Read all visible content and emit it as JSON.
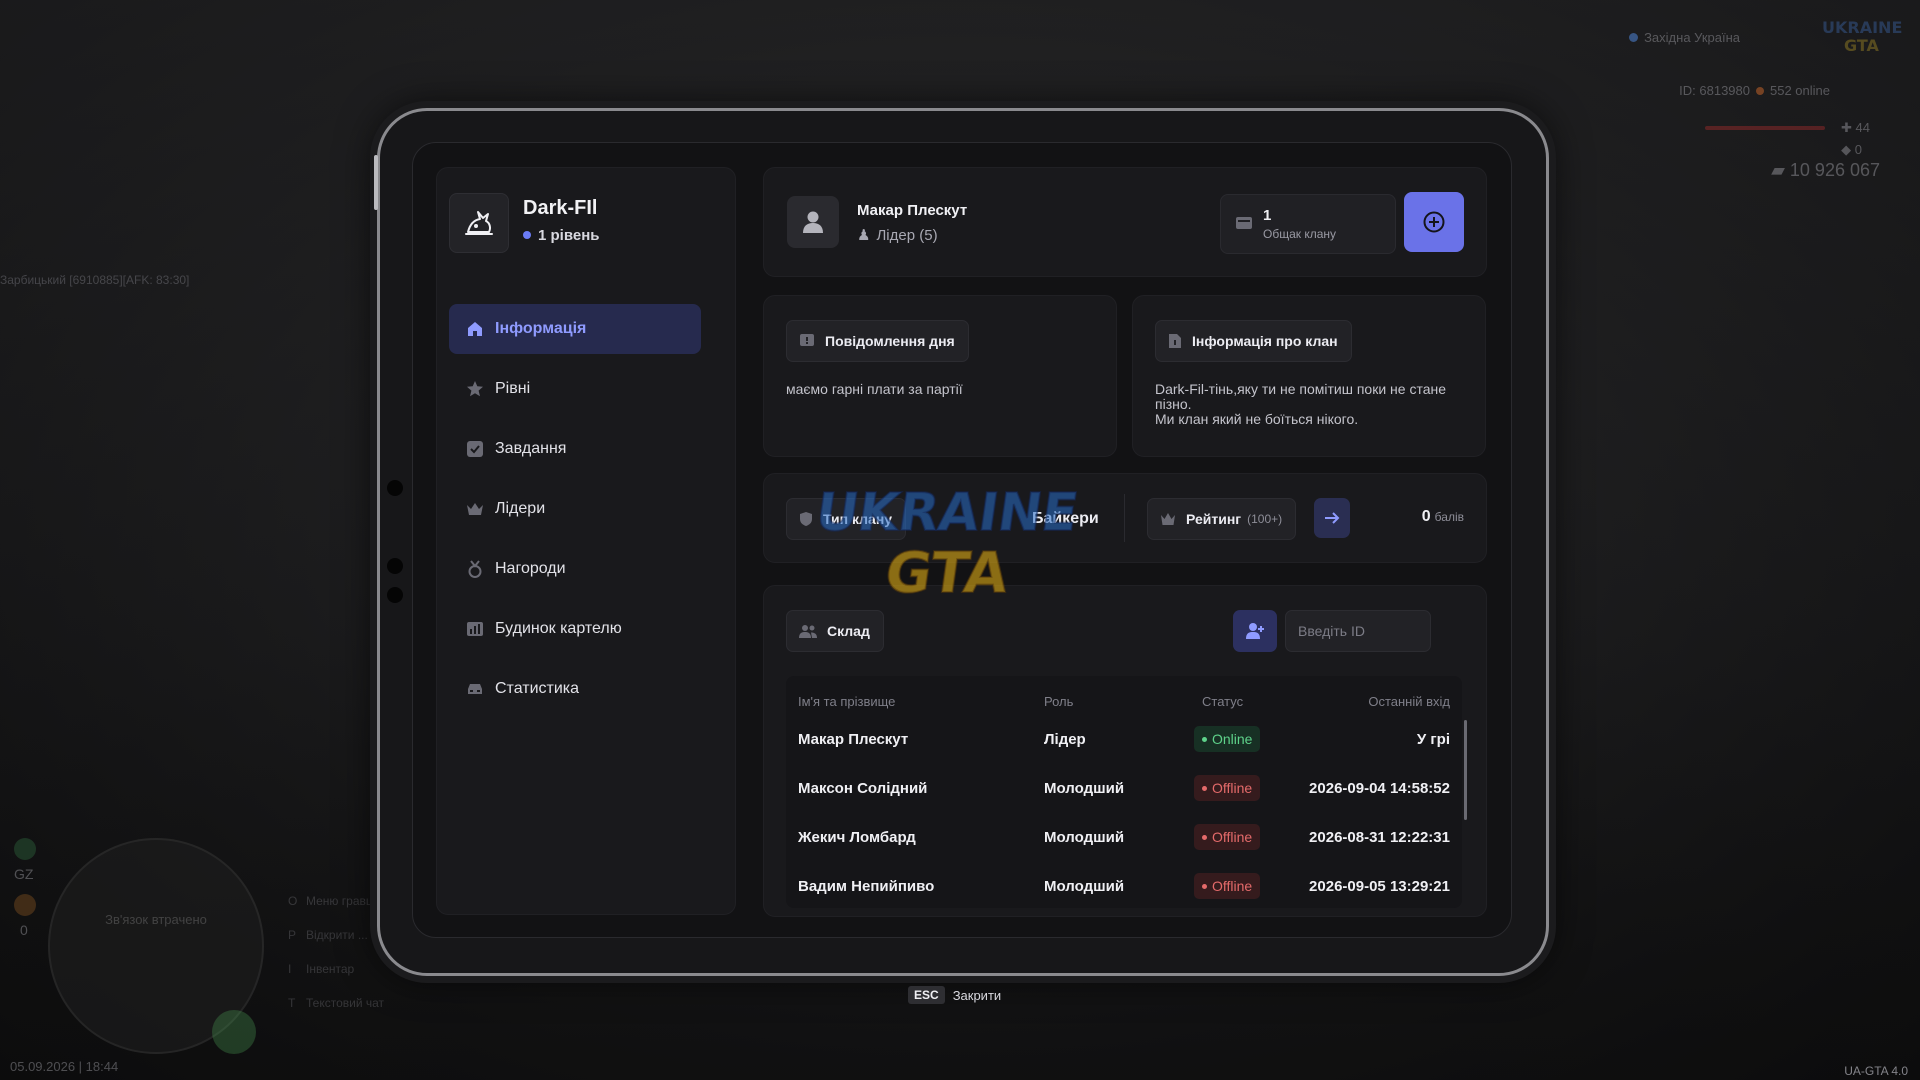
{
  "hud": {
    "region": "Західна Україна",
    "server_id": "ID: 6813980",
    "online": "552 online",
    "hp": "44",
    "armor": "0",
    "money": "10 926 067",
    "player_tag": "Зарбицький [6910885][AFK: 83:30]",
    "datetime": "05.09.2026 | 18:44",
    "version": "UA-GTA 4.0",
    "minimap_text": "Зв'язок втрачено",
    "minimap_label": "GZ",
    "minimap_value": "0",
    "keys": [
      {
        "key": "O",
        "label": "Меню гравця"
      },
      {
        "key": "P",
        "label": "Відкрити ..."
      },
      {
        "key": "I",
        "label": "Інвентар"
      },
      {
        "key": "T",
        "label": "Текстовий чат"
      }
    ]
  },
  "watermark": {
    "line1": "UKRAINE",
    "line2": "GTA"
  },
  "clan": {
    "name": "Dark-FIl",
    "level": "1 рівень"
  },
  "nav": [
    {
      "label": "Інформація",
      "icon": "home-icon",
      "active": true
    },
    {
      "label": "Рівні",
      "icon": "star-icon"
    },
    {
      "label": "Завдання",
      "icon": "checkbox-icon"
    },
    {
      "label": "Лідери",
      "icon": "crown-icon"
    },
    {
      "label": "Нагороди",
      "icon": "medal-icon"
    },
    {
      "label": "Будинок картелю",
      "icon": "building-icon"
    },
    {
      "label": "Статистика",
      "icon": "car-icon"
    }
  ],
  "leader": {
    "name": "Макар Плескут",
    "role": "Лідер (5)"
  },
  "bank": {
    "value": "1",
    "label": "Общак клану"
  },
  "motd": {
    "title": "Повідомлення дня",
    "text": "маємо гарні плати за партії"
  },
  "info": {
    "title": "Інформація про клан",
    "line1": "Dark-Fil-тінь,яку ти не помітиш поки не стане пізно.",
    "line2": "Ми клан який не боїться нікого."
  },
  "clan_type": {
    "title": "Тип клану",
    "value": "Байкери"
  },
  "rating": {
    "title": "Рейтинг",
    "sub": "(100+)",
    "points": "0",
    "unit": "балів"
  },
  "roster": {
    "title": "Склад",
    "input_placeholder": "Введіть ID",
    "columns": [
      "Ім'я та прізвище",
      "Роль",
      "Статус",
      "Останній вхід"
    ],
    "rows": [
      {
        "name": "Макар Плескут",
        "role": "Лідер",
        "status": "Online",
        "last": "У грі"
      },
      {
        "name": "Максон Солідний",
        "role": "Молодший",
        "status": "Offline",
        "last": "2026-09-04 14:58:52"
      },
      {
        "name": "Жекич Ломбард",
        "role": "Молодший",
        "status": "Offline",
        "last": "2026-08-31 12:22:31"
      },
      {
        "name": "Вадим Непийпиво",
        "role": "Молодший",
        "status": "Offline",
        "last": "2026-09-05 13:29:21"
      }
    ]
  },
  "footer": {
    "key": "ESC",
    "label": "Закрити"
  },
  "colors": {
    "accent": "#6a72e8",
    "online": "#5ed28a",
    "offline": "#e46a6a"
  }
}
